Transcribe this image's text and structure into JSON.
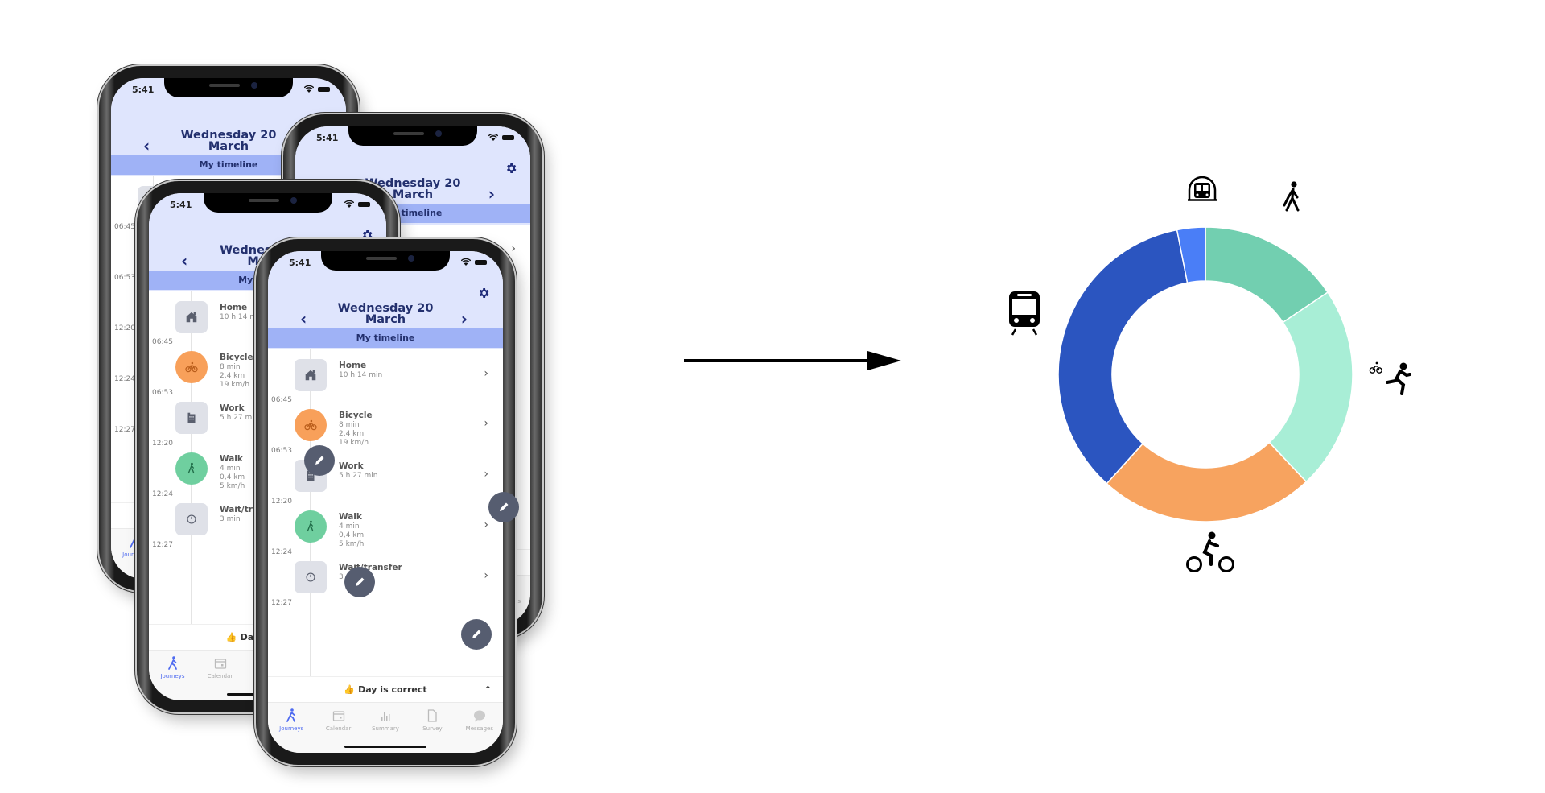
{
  "app_screen": {
    "status_time": "5:41",
    "date_title_line1": "Wednesday 20",
    "date_title_line2": "March",
    "section_tab": "My timeline",
    "events": [
      {
        "label": "Home",
        "detail": "10 h 14 min",
        "icon": "home-icon",
        "shape": "square",
        "color": "#dfe1e8"
      },
      {
        "label": "Bicycle",
        "detail": "8 min\n2,4 km\n19 km/h",
        "icon": "bicycle-icon",
        "shape": "round",
        "color": "#f8a05a"
      },
      {
        "label": "Work",
        "detail": "5 h 27 min",
        "icon": "building-icon",
        "shape": "square",
        "color": "#dfe1e8"
      },
      {
        "label": "Walk",
        "detail": "4 min\n0,4 km\n5 km/h",
        "icon": "walk-icon",
        "shape": "round",
        "color": "#6fcf9f"
      },
      {
        "label": "Wait/transfer",
        "detail": "3 min",
        "icon": "clock-icon",
        "shape": "square",
        "color": "#dfe1e8"
      }
    ],
    "time_marks": [
      "06:45",
      "06:53",
      "12:20",
      "12:24",
      "12:27"
    ],
    "day_status": "Day is correct",
    "bottom_nav": [
      {
        "label": "Journeys",
        "icon": "walk-icon",
        "active": true
      },
      {
        "label": "Calendar",
        "icon": "calendar-icon",
        "active": false
      },
      {
        "label": "Summary",
        "icon": "bar-chart-icon",
        "active": false
      },
      {
        "label": "Survey",
        "icon": "document-icon",
        "active": false
      },
      {
        "label": "Messages",
        "icon": "chat-bubble-icon",
        "active": false
      }
    ],
    "colors": {
      "header_bg": "#dfe5fd",
      "tab_bg": "#9fb2f6",
      "title_text": "#23306e",
      "active_nav": "#4f6bf0"
    }
  },
  "phones": [
    "phone-back-left",
    "phone-back-right",
    "phone-middle",
    "phone-front"
  ],
  "arrow": {
    "direction": "right"
  },
  "chart_data": {
    "type": "pie",
    "variant": "donut",
    "title": "",
    "start_angle": "12 o'clock, clockwise",
    "categories": [
      "Walk",
      "Run / micromobility",
      "Bicycle",
      "Train",
      "Metro"
    ],
    "icons": [
      "walk-icon",
      "run-bike-icon",
      "bicycle-icon",
      "train-icon",
      "metro-icon"
    ],
    "values": [
      15.6,
      22.4,
      23.7,
      35.2,
      3.1
    ],
    "colors": [
      "#72cfb0",
      "#a8eed6",
      "#f7a35f",
      "#2b55c0",
      "#4a7ef7"
    ],
    "legend": "icons around ring"
  }
}
